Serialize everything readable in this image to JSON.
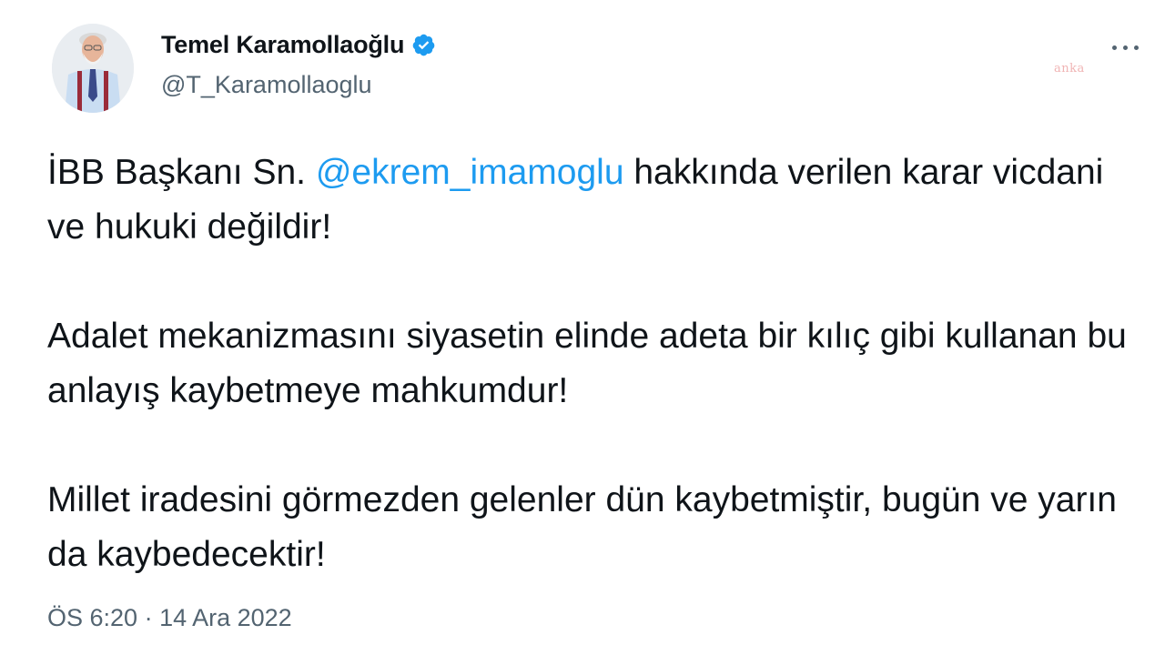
{
  "user": {
    "display_name": "Temel Karamollaoğlu",
    "handle": "@T_Karamollaoglu",
    "verified_icon": "verified-badge-icon"
  },
  "watermark": "anka",
  "tweet": {
    "p1_before": "İBB Başkanı Sn. ",
    "p1_mention": "@ekrem_imamoglu",
    "p1_after": " hakkında verilen karar vicdani ve hukuki değildir!",
    "p2": "Adalet mekanizmasını siyasetin elinde adeta bir kılıç gibi kullanan bu anlayış kaybetmeye mahkumdur!",
    "p3": "Millet iradesini görmezden gelenler dün kaybetmiştir, bugün ve yarın da kaybedecektir!"
  },
  "meta": {
    "time": "ÖS 6:20",
    "separator": " · ",
    "date": "14 Ara 2022"
  },
  "colors": {
    "mention": "#1d9bf0",
    "verified": "#1d9bf0",
    "secondary_text": "#536471",
    "primary_text": "#0f1419"
  }
}
